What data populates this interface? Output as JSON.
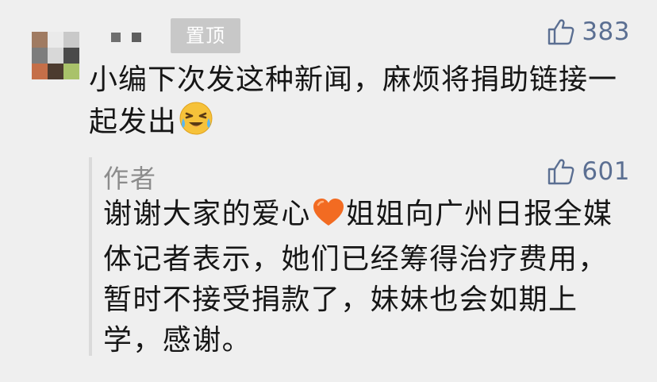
{
  "comment": {
    "avatar_colors": [
      "#a07b62",
      "#eaeaea",
      "#c9c9c9",
      "#7d7d7d",
      "#d8d8d8",
      "#4a4a4a",
      "#c56f49",
      "#4c3b2f",
      "#a9c26a"
    ],
    "pin_label": "置顶",
    "likes": "383",
    "text_parts": [
      "小编下次发这种新闻，麻烦将捐助链接一起发出"
    ],
    "emoji_icon": "crying-laughing-face-icon"
  },
  "reply": {
    "author_label": "作者",
    "likes": "601",
    "text_before_heart": "谢谢大家的爱心",
    "text_after_heart": "姐姐向广州日报全媒体记者表示，她们已经筹得治疗费用，暂时不接受捐款了，妹妹也会如期上学，感谢。",
    "heart_icon": "orange-heart-icon"
  },
  "colors": {
    "background": "#efefef",
    "like_accent": "#5b6f92",
    "author_gray": "#8c8c8c",
    "badge_bg": "#c8c8c8"
  }
}
